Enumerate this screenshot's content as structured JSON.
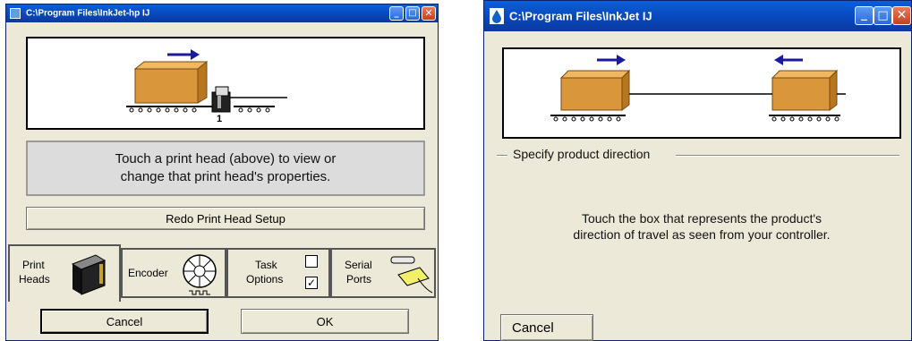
{
  "left_window": {
    "title": "C:\\Program Files\\InkJet-hp   IJ",
    "head_number": "1",
    "message_line1": "Touch a print head (above) to view or",
    "message_line2": "change that print head's properties.",
    "redo_button": "Redo Print Head Setup",
    "tabs": {
      "print_heads_line1": "Print",
      "print_heads_line2": "Heads",
      "encoder": "Encoder",
      "task_options_line1": "Task",
      "task_options_line2": "Options",
      "serial_ports_line1": "Serial",
      "serial_ports_line2": "Ports"
    },
    "task_checkbox_top_checked": false,
    "task_checkbox_bottom_checked": true,
    "cancel_button": "Cancel",
    "ok_button": "OK"
  },
  "right_window": {
    "title": "C:\\Program Files\\InkJet   IJ",
    "group_label": "Specify product direction",
    "message_line1": "Touch the box that represents the product's",
    "message_line2": "direction of travel as seen from your controller.",
    "cancel_button": "Cancel"
  },
  "colors": {
    "titlebar": "#0846b9",
    "box": "#d9963a",
    "arrow": "#1a1aa0",
    "window_bg": "#ece9d8"
  }
}
